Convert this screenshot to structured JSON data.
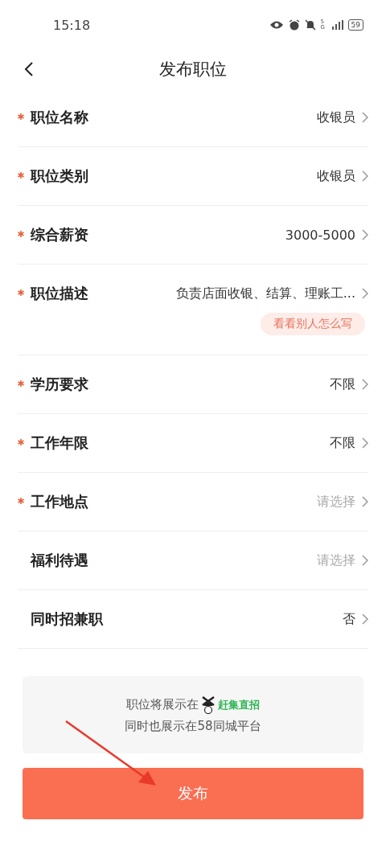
{
  "status_bar": {
    "time": "15:18",
    "battery": "59",
    "network": "5G"
  },
  "header": {
    "title": "发布职位"
  },
  "fields": [
    {
      "label": "职位名称",
      "required": true,
      "value": "收银员",
      "filled": true
    },
    {
      "label": "职位类别",
      "required": true,
      "value": "收银员",
      "filled": true
    },
    {
      "label": "综合薪资",
      "required": true,
      "value": "3000-5000",
      "filled": true
    },
    {
      "label": "职位描述",
      "required": true,
      "value": "负责店面收银、结算、理账工...",
      "filled": true,
      "hint_button": "看看别人怎么写"
    },
    {
      "label": "学历要求",
      "required": true,
      "value": "不限",
      "filled": true
    },
    {
      "label": "工作年限",
      "required": true,
      "value": "不限",
      "filled": true
    },
    {
      "label": "工作地点",
      "required": true,
      "placeholder": "请选择"
    },
    {
      "label": "福利待遇",
      "required": false,
      "placeholder": "请选择"
    },
    {
      "label": "同时招兼职",
      "required": false,
      "value": "否",
      "filled": true
    }
  ],
  "notice": {
    "line1": "职位将展示在",
    "brand": "赶集直招",
    "line2": "同时也展示在58同城平台"
  },
  "submit_button": "发布"
}
